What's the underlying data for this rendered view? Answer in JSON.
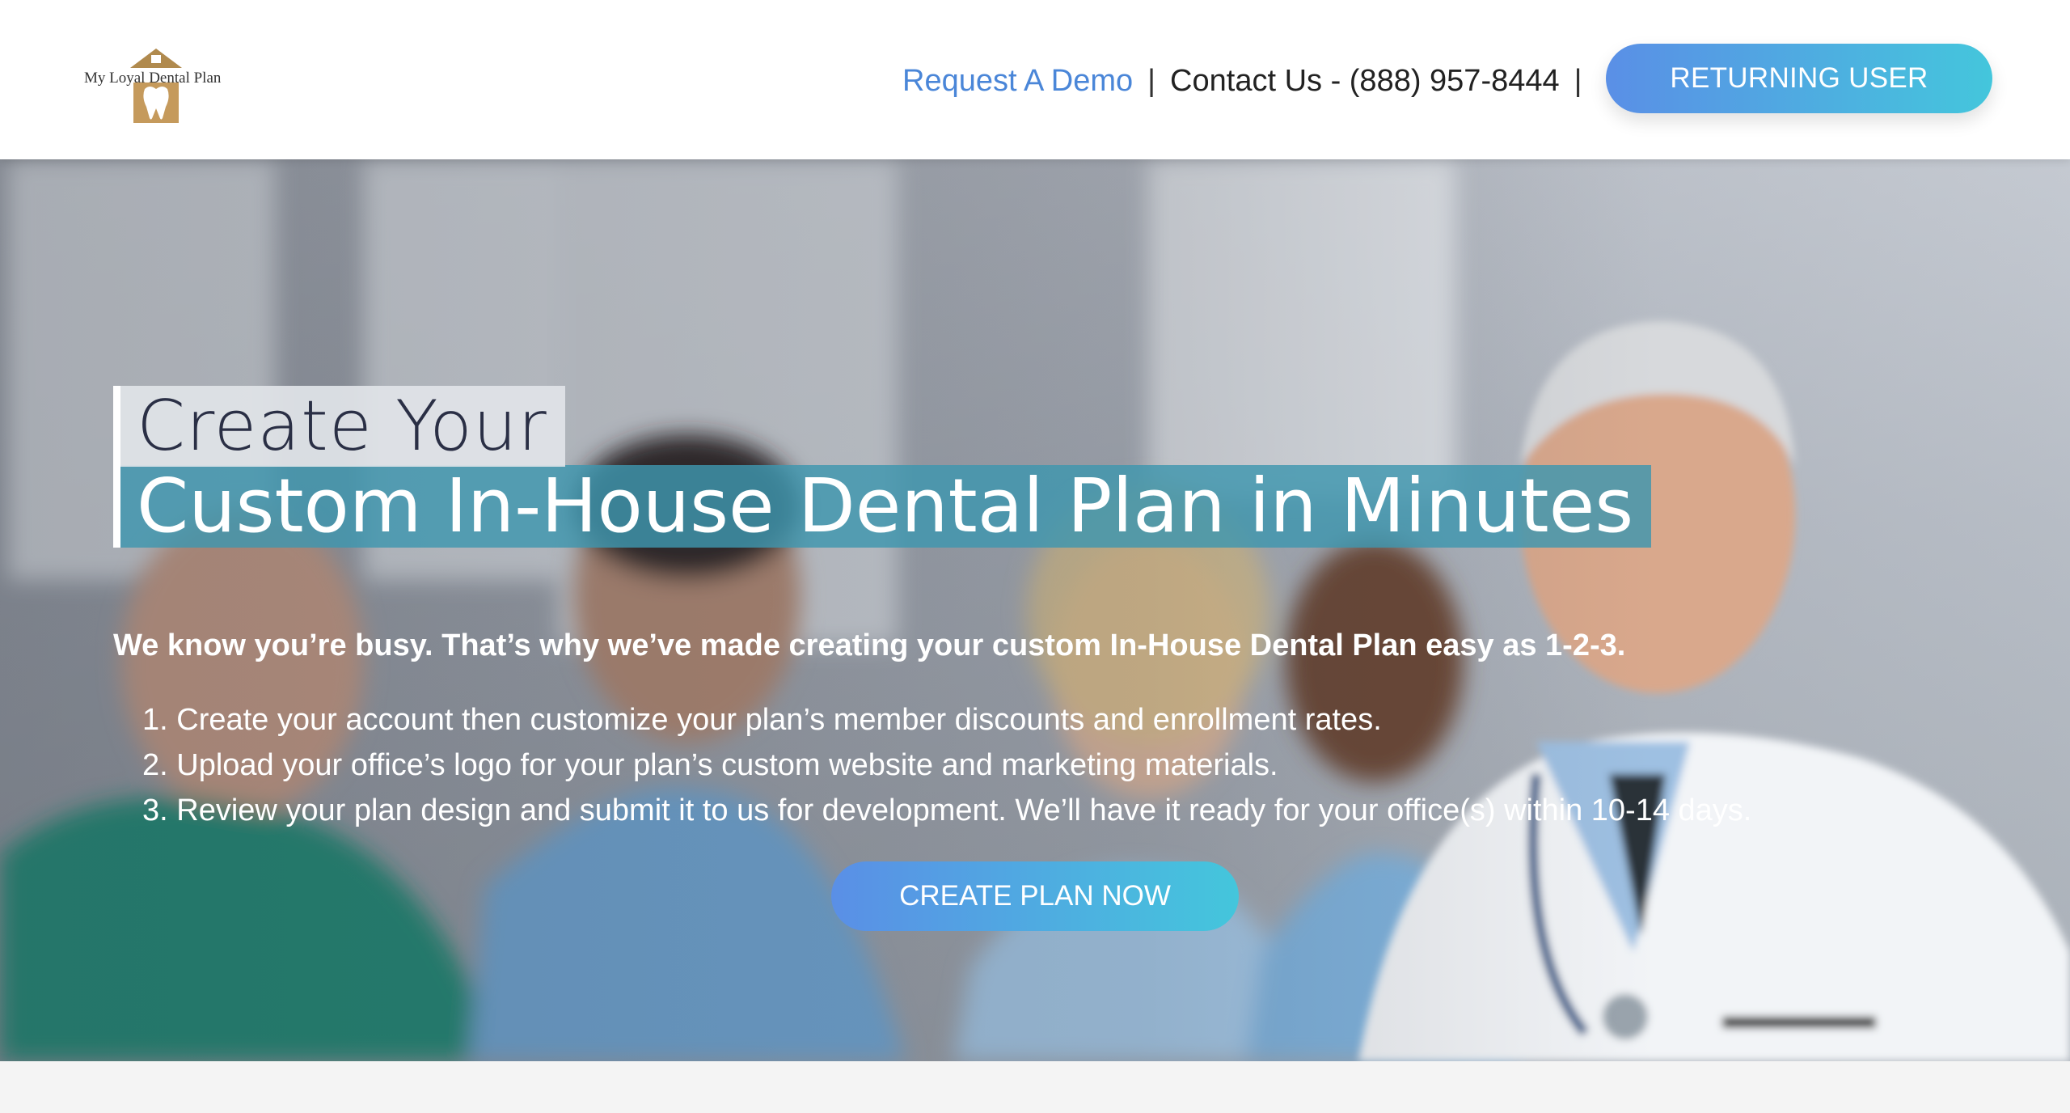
{
  "header": {
    "logo_text": "My Loyal Dental Plan",
    "nav": {
      "request_demo": "Request A Demo",
      "separator": "|",
      "contact": "Contact Us - (888) 957-8444"
    },
    "returning_user_label": "RETURNING USER"
  },
  "hero": {
    "title_line1": "Create Your",
    "title_line2": "Custom In-House Dental Plan in Minutes",
    "subline": "We know you’re busy. That’s why we’ve made creating your custom In-House Dental Plan easy as 1-2-3.",
    "steps": [
      "1. Create your account then customize your plan’s member discounts and enrollment rates.",
      "2. Upload your office’s logo for your plan’s custom website and marketing materials.",
      "3. Review your plan design and submit it to us for development. We’ll have it ready for your office(s) within 10-14 days."
    ],
    "cta_label": "CREATE PLAN NOW"
  },
  "colors": {
    "accent_gradient_start": "#5a8fe6",
    "accent_gradient_end": "#44c6dc",
    "title_highlight": "#3e96af",
    "link_blue": "#4a86d8"
  }
}
